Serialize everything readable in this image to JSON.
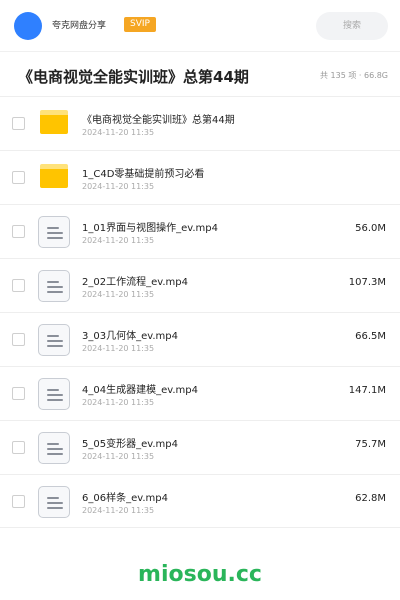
{
  "header": {
    "uploader": "夸克网盘分享",
    "badge": "SVIP",
    "search_placeholder": "搜索"
  },
  "folder_title": "《电商视觉全能实训班》总第44期",
  "stats": "共 135 项 · 66.8G",
  "files": [
    {
      "type": "folder",
      "icon": "folder-icon",
      "name": "《电商视觉全能实训班》总第44期",
      "date": "2024-11-20 11:35",
      "size": ""
    },
    {
      "type": "folder",
      "icon": "folder-icon",
      "name": "1_C4D零基础提前预习必看",
      "date": "2024-11-20 11:35",
      "size": ""
    },
    {
      "type": "file",
      "icon": "file-icon",
      "name": "1_01界面与视图操作_ev.mp4",
      "date": "2024-11-20 11:35",
      "size": "56.0M"
    },
    {
      "type": "file",
      "icon": "file-icon",
      "name": "2_02工作流程_ev.mp4",
      "date": "2024-11-20 11:35",
      "size": "107.3M"
    },
    {
      "type": "file",
      "icon": "file-icon",
      "name": "3_03几何体_ev.mp4",
      "date": "2024-11-20 11:35",
      "size": "66.5M"
    },
    {
      "type": "file",
      "icon": "file-icon",
      "name": "4_04生成器建模_ev.mp4",
      "date": "2024-11-20 11:35",
      "size": "147.1M"
    },
    {
      "type": "file",
      "icon": "file-icon",
      "name": "5_05变形器_ev.mp4",
      "date": "2024-11-20 11:35",
      "size": "75.7M"
    },
    {
      "type": "file",
      "icon": "file-icon",
      "name": "6_06样条_ev.mp4",
      "date": "2024-11-20 11:35",
      "size": "62.8M"
    }
  ],
  "watermark": "miosou.cc",
  "colors": {
    "accent": "#2f80ff",
    "badge": "#f5a623",
    "folder": "#ffc400",
    "watermark": "#2ab55a"
  }
}
